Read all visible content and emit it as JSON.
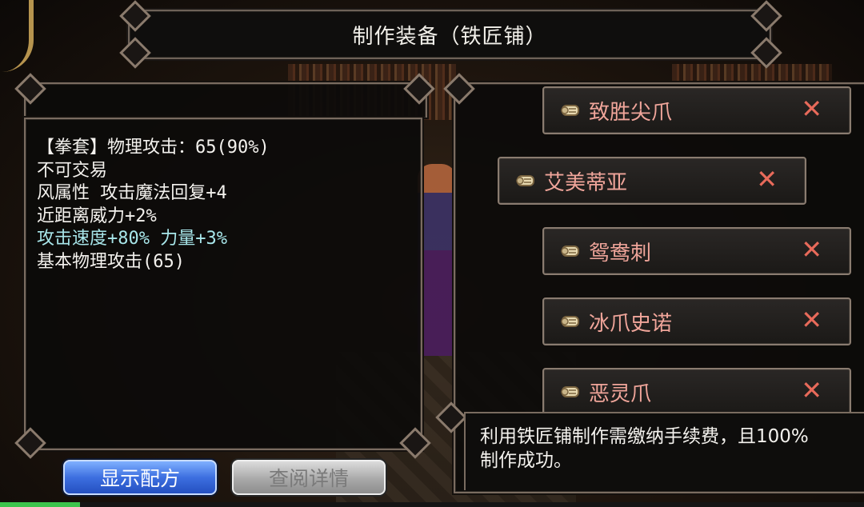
{
  "window": {
    "title": "制作装备（铁匠铺）"
  },
  "item_info": {
    "lines": [
      "【拳套】物理攻击：65(90%)",
      "不可交易",
      "风属性 攻击魔法回复+4",
      "近距离威力+2%",
      "攻击速度+80% 力量+3%",
      "基本物理攻击(65)"
    ]
  },
  "recipes": [
    {
      "name": "致胜尖爪",
      "icon": "scroll-icon",
      "close": "✕"
    },
    {
      "name": "艾美蒂亚",
      "icon": "scroll-icon",
      "close": "✕"
    },
    {
      "name": "鸳鸯刺",
      "icon": "scroll-icon",
      "close": "✕"
    },
    {
      "name": "冰爪史诺",
      "icon": "scroll-icon",
      "close": "✕"
    },
    {
      "name": "恶灵爪",
      "icon": "scroll-icon",
      "close": "✕"
    }
  ],
  "notice": {
    "line1": "利用铁匠铺制作需缴纳手续费，且100%",
    "line2": "制作成功。"
  },
  "buttons": {
    "show_recipe": "显示配方",
    "view_details": "查阅详情"
  },
  "colors": {
    "recipe_text": "#f0a59a",
    "close_x": "#e86a5a",
    "highlight_text": "#a8e6ea",
    "primary_button": "#3d6fe0"
  }
}
